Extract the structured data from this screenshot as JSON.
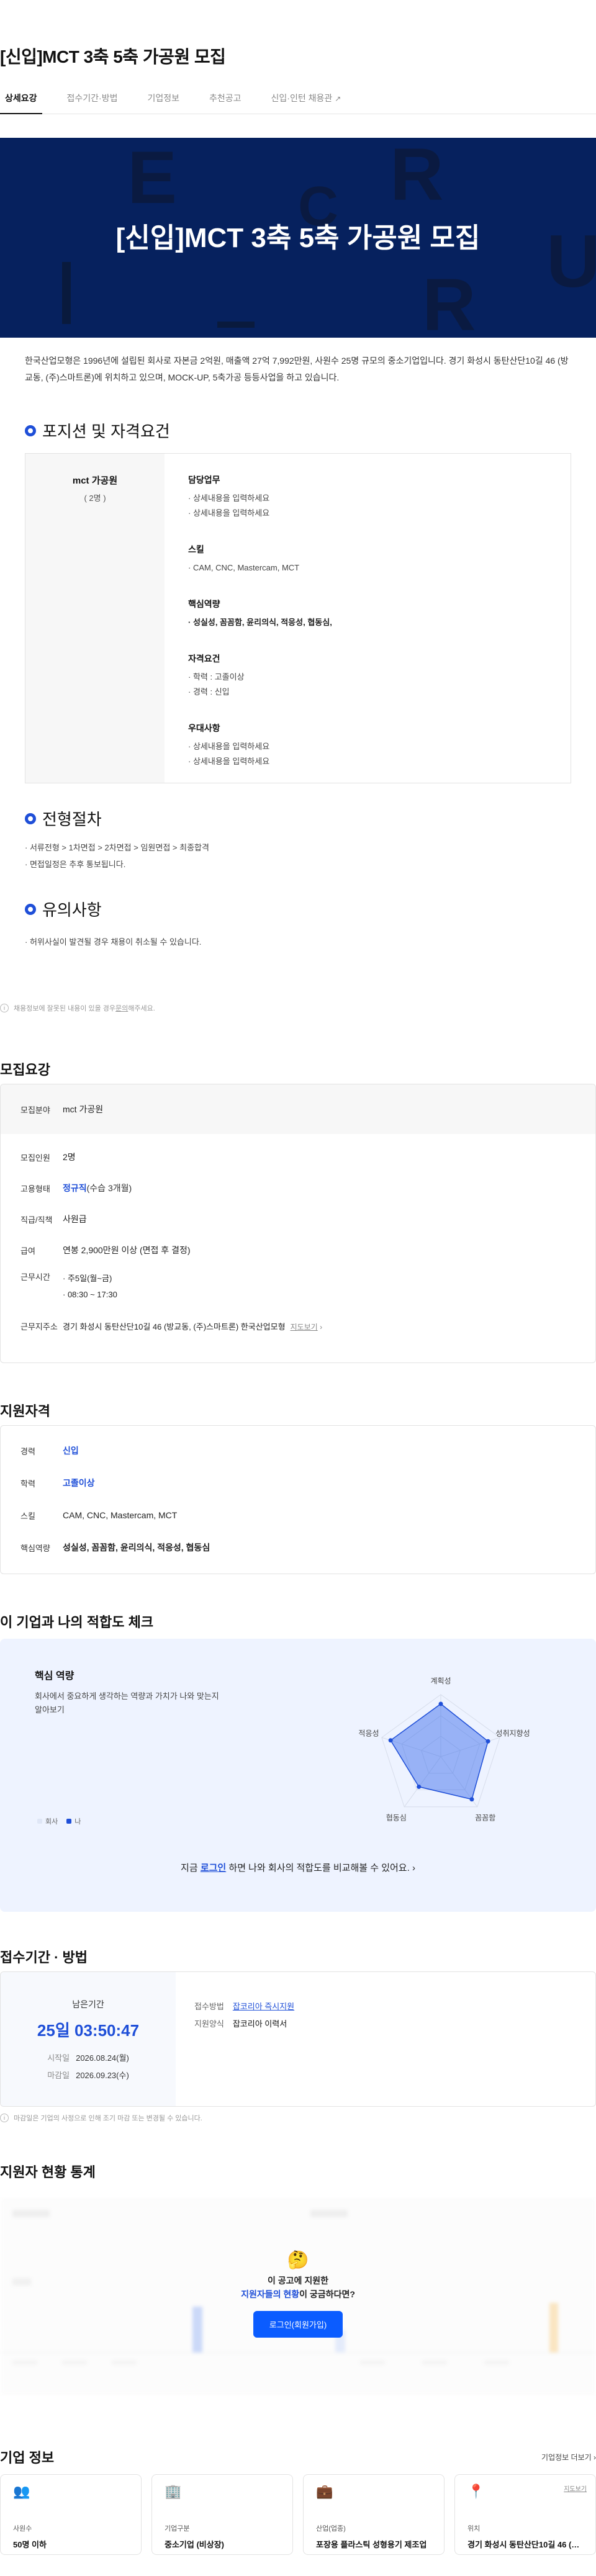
{
  "title": "[신입]MCT 3축 5축 가공원 모집",
  "tabs": [
    {
      "label": "상세요강",
      "active": true
    },
    {
      "label": "접수기간·방법"
    },
    {
      "label": "기업정보"
    },
    {
      "label": "추천공고"
    },
    {
      "label": "신입·인턴 채용관",
      "external_icon": "external-link-icon"
    }
  ],
  "banner": {
    "title": "[신입]MCT 3축 5축 가공원 모집",
    "background": "#06215e"
  },
  "intro": "한국산업모형은 1996년에 설립된 회사로 자본금 2억원, 매출액 27억 7,992만원, 사원수 25명 규모의 중소기업입니다. 경기 화성시 동탄산단10길 46 (방교동, (주)스마트론)에 위치하고 있으며, MOCK-UP, 5축가공 등등사업을 하고 있습니다.",
  "position_section": {
    "heading": "포지션 및 자격요건",
    "position_name": "mct 가공원",
    "position_count": "( 2명 )",
    "groups": [
      {
        "title": "담당업무",
        "items": [
          "상세내용을 입력하세요",
          "상세내용을 입력하세요"
        ]
      },
      {
        "title": "스킬",
        "items": [
          "CAM, CNC, Mastercam, MCT"
        ]
      },
      {
        "title": "핵심역량",
        "items": [
          "성실성, 꼼꼼함, 윤리의식, 적응성, 협동심,"
        ],
        "bold": true
      },
      {
        "title": "자격요건",
        "items": [
          "학력 : 고졸이상",
          "경력 : 신입"
        ]
      },
      {
        "title": "우대사항",
        "items": [
          "상세내용을 입력하세요",
          "상세내용을 입력하세요"
        ]
      }
    ]
  },
  "process_section": {
    "heading": "전형절차",
    "items": [
      "서류전형 > 1차면접 > 2차면접 > 임원면접 > 최종합격",
      "면접일정은 추후 통보됩니다."
    ]
  },
  "notes_section": {
    "heading": "유의사항",
    "items": [
      "허위사실이 발견될 경우 채용이 취소될 수 있습니다."
    ]
  },
  "report_note": {
    "prefix": "채용정보에 잘못된 내용이 있을 경우 ",
    "link": "문의",
    "suffix": "해주세요."
  },
  "recruit": {
    "heading": "모집요강",
    "field_label": "모집분야",
    "field_value": "mct 가공원",
    "rows": [
      {
        "k": "모집인원",
        "v": "2명"
      },
      {
        "k": "고용형태",
        "v": "정규직",
        "sub": "(수습 3개월)"
      },
      {
        "k": "직급/직책",
        "v": "사원급"
      },
      {
        "k": "급여",
        "v": "연봉 2,900만원 이상 (면접 후 결정)"
      }
    ],
    "hours_label": "근무시간",
    "hours": [
      "주5일(월~금)",
      "08:30 ~ 17:30"
    ],
    "address_label": "근무지주소",
    "address": "경기 화성시 동탄산단10길 46 (방교동, (주)스마트론) 한국산업모형",
    "map_link": "지도보기"
  },
  "qualification": {
    "heading": "지원자격",
    "rows": [
      {
        "k": "경력",
        "v": "신입",
        "style": "blue"
      },
      {
        "k": "학력",
        "v": "고졸이상",
        "style": "blue"
      },
      {
        "k": "스킬",
        "v": "CAM, CNC, Mastercam, MCT",
        "style": ""
      },
      {
        "k": "핵심역량",
        "v": "성실성, 꼼꼼함, 윤리의식, 적응성, 협동심",
        "style": "bold"
      }
    ]
  },
  "fit": {
    "heading": "이 기업과 나의 적합도 체크",
    "title": "핵심 역량",
    "desc": "회사에서 중요하게 생각하는 역량과 가치가 나와 맞는지 알아보기",
    "axes": [
      "계획성",
      "성취지향성",
      "꼼꼼함",
      "협동심",
      "적응성"
    ],
    "company_values": [
      0.85,
      0.8,
      0.85,
      0.6,
      0.85
    ],
    "legend_company": "회사",
    "legend_me": "나",
    "cta_prefix": "지금 ",
    "cta_link": "로그인",
    "cta_suffix": " 하면 나와 회사의 적합도를 비교해볼 수 있어요.",
    "accent": "#1f4fd8"
  },
  "period": {
    "heading": "접수기간 · 방법",
    "remaining_label": "남은기간",
    "countdown": "25일 03:50:47",
    "start_label": "시작일",
    "start": "2026.08.24(월)",
    "end_label": "마감일",
    "end": "2026.09.23(수)",
    "method_label": "접수방법",
    "method": "잡코리아 즉시지원",
    "form_label": "지원양식",
    "form": "잡코리아 이력서",
    "footnote": "마감일은 기업의 사정으로 인해 조기 마감 또는 변경될 수 있습니다."
  },
  "stats": {
    "heading": "지원자 현황 통계",
    "question_line1": "이 공고에 지원한",
    "question_blue": "지원자들의 현황",
    "question_rest": "이 궁금하다면?",
    "button": "로그인(회원가입)"
  },
  "company": {
    "heading": "기업 정보",
    "more": "기업정보 더보기",
    "cards": [
      {
        "icon": "people-icon",
        "glyph": "👥",
        "label": "사원수",
        "value": "50명 이하"
      },
      {
        "icon": "building-icon",
        "glyph": "🏢",
        "label": "기업구분",
        "value": "중소기업 (비상장)"
      },
      {
        "icon": "briefcase-icon",
        "glyph": "💼",
        "label": "산업(업종)",
        "value": "포장용 플라스틱 성형용기 제조업"
      },
      {
        "icon": "location-pin-icon",
        "glyph": "📍",
        "label": "위치",
        "value": "경기 화성시 동탄산단10길 46 (방교동, (주)스마트론)",
        "map": "지도보기"
      }
    ]
  }
}
